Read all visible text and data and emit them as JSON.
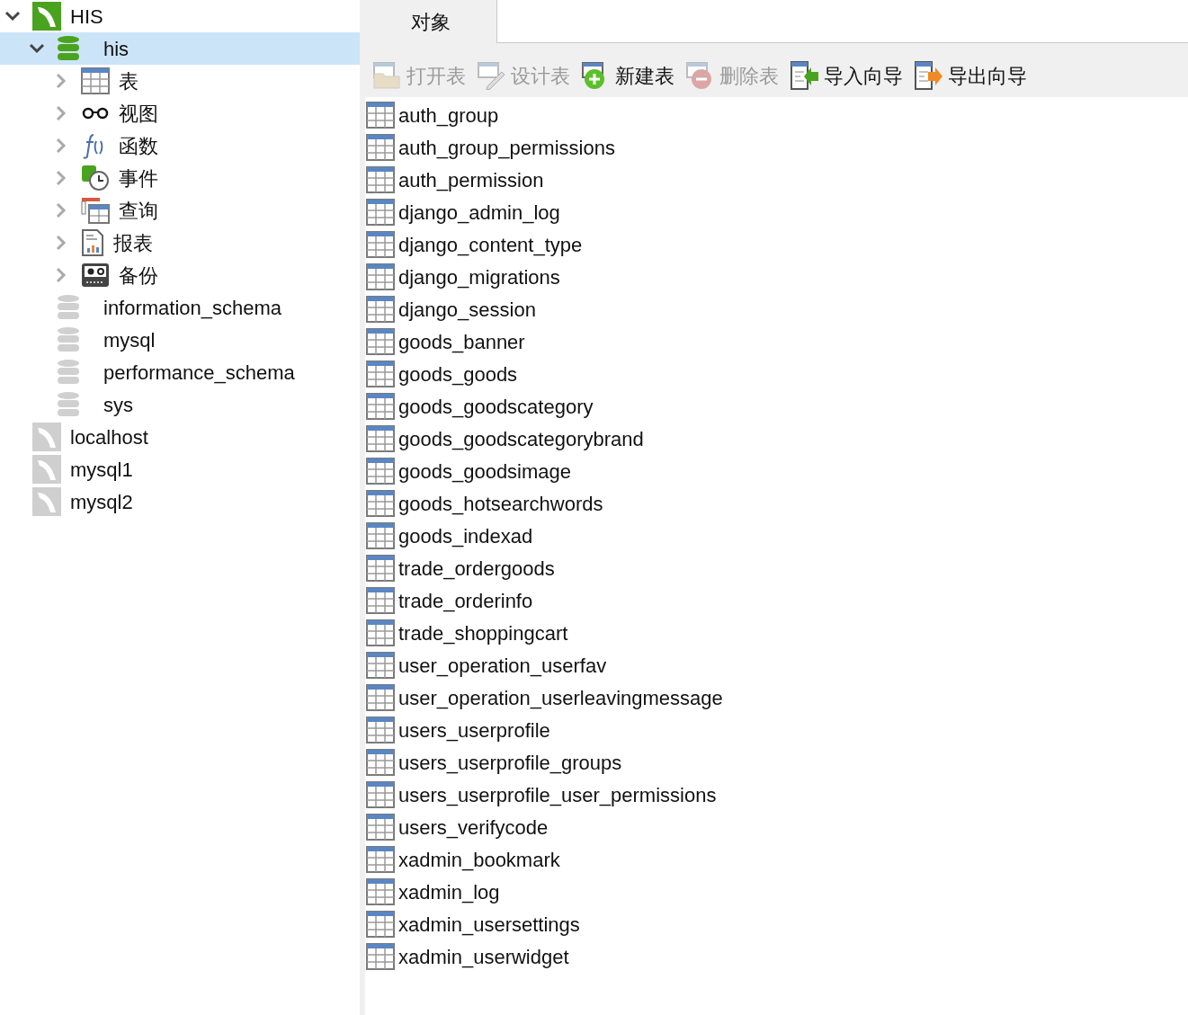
{
  "tree": [
    {
      "label": "HIS",
      "kind": "connection",
      "connected": true,
      "expanded": true,
      "selected": false,
      "children": [
        {
          "label": "his",
          "kind": "database",
          "open": true,
          "expanded": true,
          "selected": true,
          "children": [
            {
              "label": "表",
              "kind": "tables",
              "expanded": false,
              "selected": false
            },
            {
              "label": "视图",
              "kind": "views",
              "expanded": false,
              "selected": false
            },
            {
              "label": "函数",
              "kind": "functions",
              "expanded": false,
              "selected": false
            },
            {
              "label": "事件",
              "kind": "events",
              "expanded": false,
              "selected": false
            },
            {
              "label": "查询",
              "kind": "queries",
              "expanded": false,
              "selected": false
            },
            {
              "label": "报表",
              "kind": "reports",
              "expanded": false,
              "selected": false
            },
            {
              "label": "备份",
              "kind": "backups",
              "expanded": false,
              "selected": false
            }
          ]
        },
        {
          "label": "information_schema",
          "kind": "database",
          "open": false,
          "selected": false
        },
        {
          "label": "mysql",
          "kind": "database",
          "open": false,
          "selected": false
        },
        {
          "label": "performance_schema",
          "kind": "database",
          "open": false,
          "selected": false
        },
        {
          "label": "sys",
          "kind": "database",
          "open": false,
          "selected": false
        }
      ]
    },
    {
      "label": "localhost",
      "kind": "connection",
      "connected": false,
      "selected": false
    },
    {
      "label": "mysql1",
      "kind": "connection",
      "connected": false,
      "selected": false
    },
    {
      "label": "mysql2",
      "kind": "connection",
      "connected": false,
      "selected": false
    }
  ],
  "tabs": [
    {
      "label": "对象",
      "selected": true
    }
  ],
  "toolbar": [
    {
      "label": "打开表",
      "kind": "open",
      "disabled": true
    },
    {
      "label": "设计表",
      "kind": "design",
      "disabled": true
    },
    {
      "label": "新建表",
      "kind": "new",
      "disabled": false
    },
    {
      "label": "删除表",
      "kind": "delete",
      "disabled": true
    },
    {
      "label": "导入向导",
      "kind": "import",
      "disabled": false
    },
    {
      "label": "导出向导",
      "kind": "export",
      "disabled": false
    }
  ],
  "tables": [
    "auth_group",
    "auth_group_permissions",
    "auth_permission",
    "django_admin_log",
    "django_content_type",
    "django_migrations",
    "django_session",
    "goods_banner",
    "goods_goods",
    "goods_goodscategory",
    "goods_goodscategorybrand",
    "goods_goodsimage",
    "goods_hotsearchwords",
    "goods_indexad",
    "trade_ordergoods",
    "trade_orderinfo",
    "trade_shoppingcart",
    "user_operation_userfav",
    "user_operation_userleavingmessage",
    "users_userprofile",
    "users_userprofile_groups",
    "users_userprofile_user_permissions",
    "users_verifycode",
    "xadmin_bookmark",
    "xadmin_log",
    "xadmin_usersettings",
    "xadmin_userwidget"
  ]
}
